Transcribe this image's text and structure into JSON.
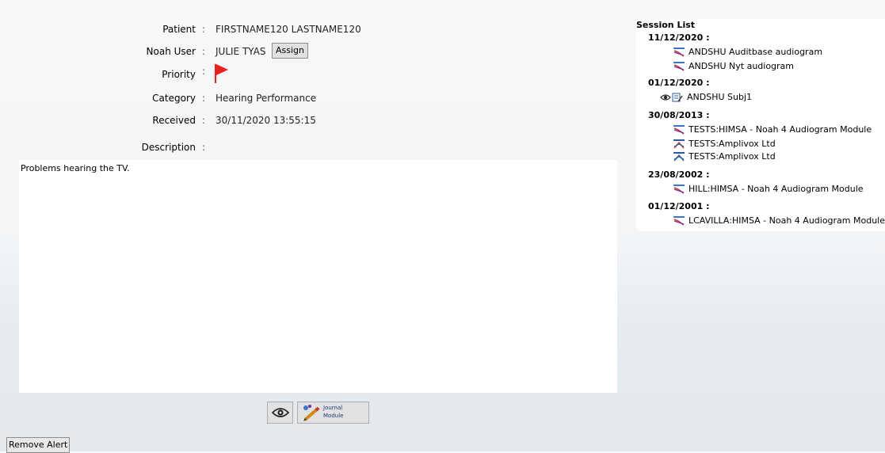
{
  "patient": {
    "patient_label": "Patient",
    "patient_value": "FIRSTNAME120 LASTNAME120",
    "noah_user_label": "Noah User",
    "noah_user_value": "JULIE TYAS",
    "assign_label": "Assign",
    "priority_label": "Priority",
    "priority_flag_color": "#e52222",
    "category_label": "Category",
    "category_value": "Hearing Performance",
    "received_label": "Received",
    "received_value": "30/11/2020 13:55:15",
    "description_label": "Description",
    "colon": ":"
  },
  "description": {
    "text": "Problems hearing the TV."
  },
  "toolbar": {
    "view_icon": "eye-icon",
    "journal_line1": "Journal",
    "journal_line2": "Module"
  },
  "remove_alert_label": "Remove Alert",
  "session_list": {
    "title": "Session List",
    "groups": [
      {
        "date": "11/12/2020 :",
        "items": [
          {
            "icon": "audiogram-icon",
            "label": "ANDSHU Auditbase audiogram"
          },
          {
            "icon": "audiogram-icon",
            "label": "ANDSHU Nyt audiogram"
          }
        ]
      },
      {
        "date": "01/12/2020 :",
        "items": [
          {
            "icon": "journal-icon",
            "label": "ANDSHU Subj1"
          }
        ]
      },
      {
        "date": "30/08/2013 :",
        "items": [
          {
            "icon": "audiogram-icon",
            "label": "TESTS:HIMSA  - Noah 4 Audiogram Module"
          },
          {
            "icon": "amplivox-icon",
            "label": "TESTS:Amplivox Ltd"
          },
          {
            "icon": "amplivox-icon",
            "label": "TESTS:Amplivox Ltd"
          }
        ]
      },
      {
        "date": "23/08/2002 :",
        "items": [
          {
            "icon": "audiogram-icon",
            "label": "HILL:HIMSA  - Noah 4 Audiogram Module"
          }
        ]
      },
      {
        "date": "01/12/2001 :",
        "items": [
          {
            "icon": "audiogram-icon",
            "label": "LCAVILLA:HIMSA  - Noah 4 Audiogram Module"
          }
        ]
      }
    ]
  }
}
